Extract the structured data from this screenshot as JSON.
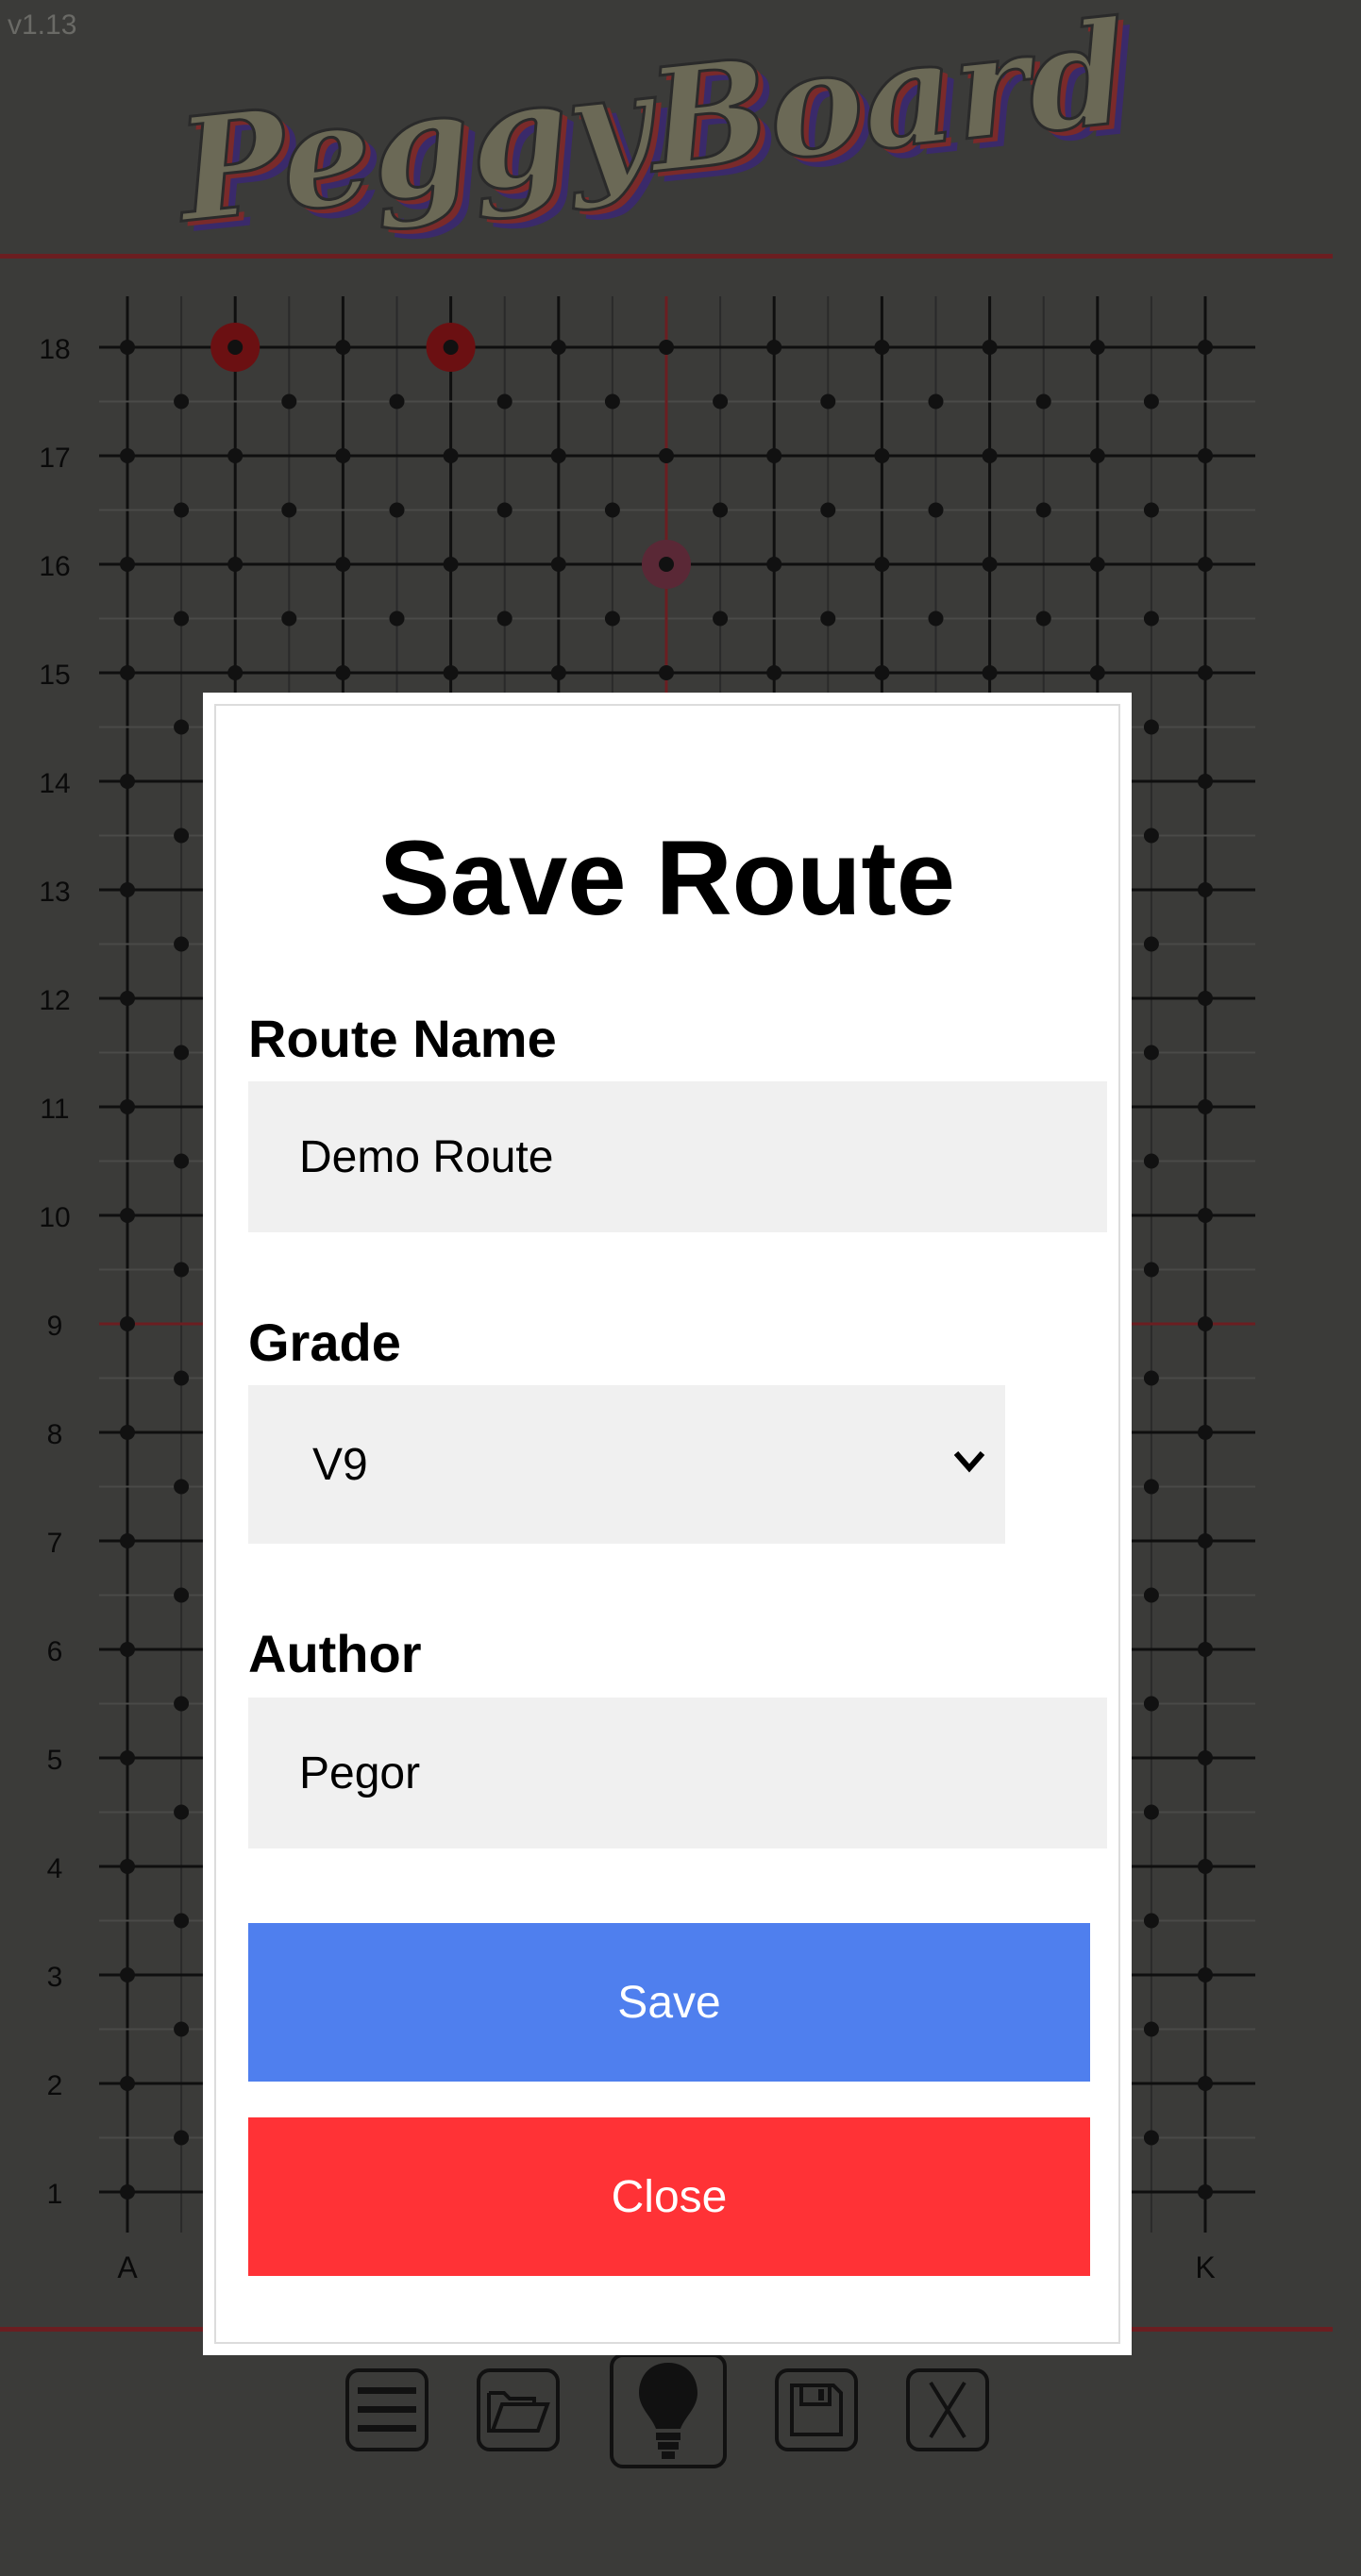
{
  "app": {
    "version": "v1.13",
    "logo_text": "PeggyBoard"
  },
  "board": {
    "row_labels": [
      "18",
      "17",
      "16",
      "15",
      "14",
      "13",
      "12",
      "11",
      "10",
      "9",
      "8",
      "7",
      "6",
      "5",
      "4",
      "3",
      "2",
      "1"
    ],
    "column_labels": [
      "A",
      "K"
    ]
  },
  "toolbar": {
    "items": [
      {
        "icon": "menu-icon"
      },
      {
        "icon": "folder-open-icon"
      },
      {
        "icon": "lightbulb-icon"
      },
      {
        "icon": "save-disk-icon"
      },
      {
        "icon": "close-x-icon"
      }
    ]
  },
  "modal": {
    "title": "Save Route",
    "route_name_label": "Route Name",
    "route_name_value": "Demo Route",
    "grade_label": "Grade",
    "grade_value": "V9",
    "author_label": "Author",
    "author_value": "Pegor",
    "save_label": "Save",
    "close_label": "Close"
  },
  "colors": {
    "background": "#3b3b39",
    "divider": "#6b1e21",
    "save_button": "#4f7fee",
    "close_button": "#ff3236",
    "input_bg": "#f0f0f0"
  }
}
